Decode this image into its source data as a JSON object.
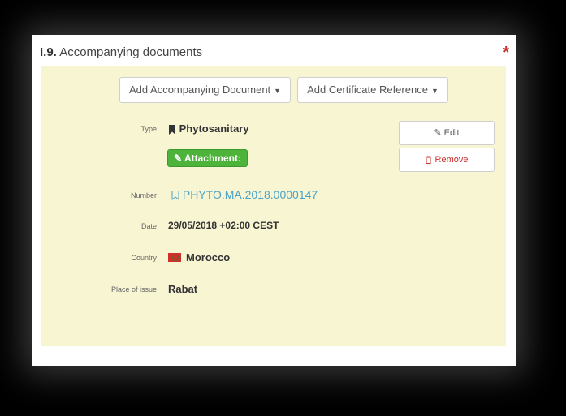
{
  "section": {
    "number": "I.9.",
    "title": "Accompanying documents",
    "required_mark": "*"
  },
  "actions": {
    "add_document": "Add Accompanying Document",
    "add_certificate": "Add Certificate Reference"
  },
  "document": {
    "type_label": "Type",
    "type_value": "Phytosanitary",
    "attachment_label": "Attachment:",
    "number_label": "Number",
    "number_value": "PHYTO.MA.2018.0000147",
    "date_label": "Date",
    "date_value": "29/05/2018 +02:00 CEST",
    "country_label": "Country",
    "country_value": "Morocco",
    "place_label": "Place of issue",
    "place_value": "Rabat"
  },
  "buttons": {
    "edit": "Edit",
    "remove": "Remove"
  },
  "colors": {
    "panel_bg": "#f8f5d3",
    "badge_green": "#4db33b",
    "link_blue": "#4aa3c8",
    "danger_red": "#c9302c"
  },
  "icons": {
    "type": "bookmark-icon",
    "attachment": "pencil-icon",
    "number": "bookmark-outline-icon",
    "country": "morocco-flag-icon",
    "edit": "edit-icon",
    "remove": "trash-icon"
  }
}
